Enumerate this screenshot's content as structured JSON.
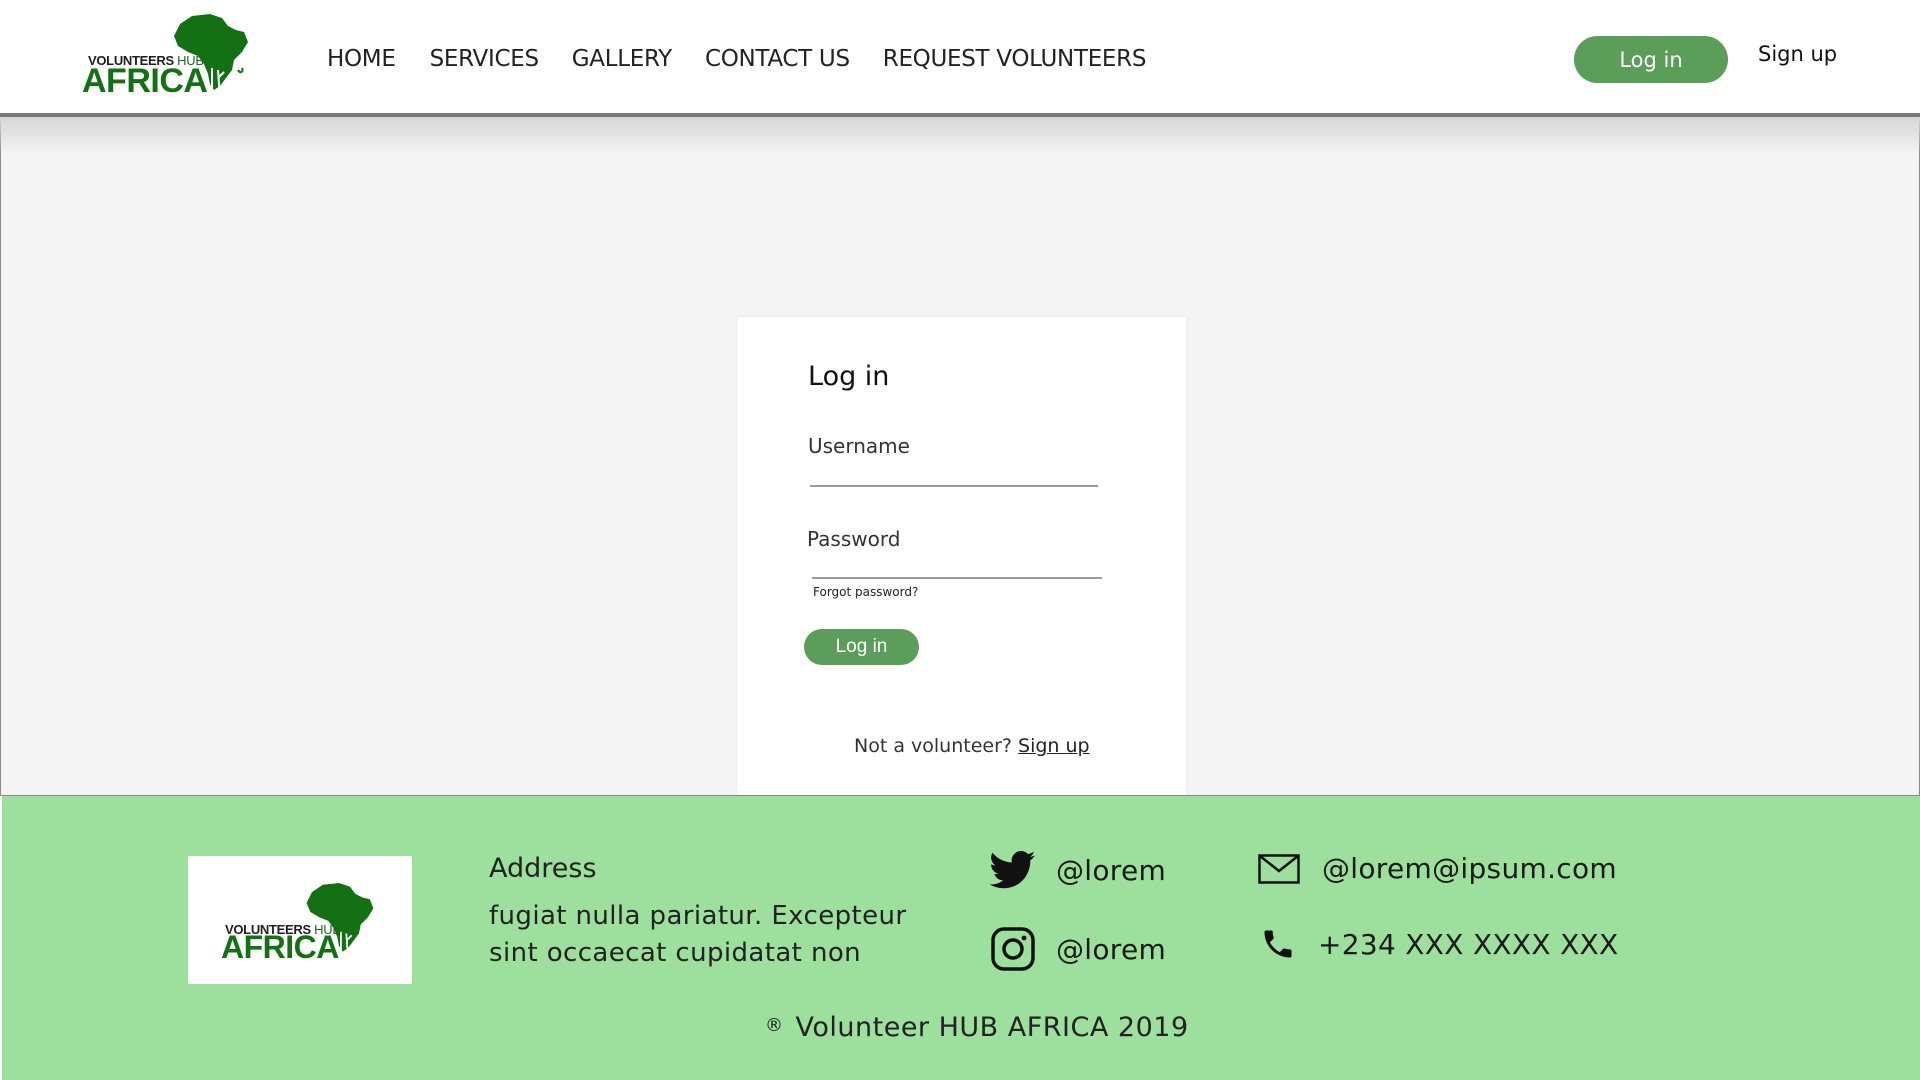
{
  "brand": {
    "logo_top_text": "VOLUNTEERS",
    "logo_hub_text": "HUB",
    "logo_main_text": "AFRICA",
    "logo_color": "#137013"
  },
  "nav": {
    "items": [
      "HOME",
      "SERVICES",
      "GALLERY",
      "CONTACT US",
      "REQUEST VOLUNTEERS"
    ]
  },
  "header": {
    "login_label": "Log in",
    "signup_label": "Sign up"
  },
  "login_card": {
    "title": "Log in",
    "username_label": "Username",
    "username_value": "",
    "password_label": "Password",
    "password_value": "",
    "forgot_label": "Forgot password?",
    "submit_label": "Log in",
    "not_volunteer_text": "Not a volunteer?",
    "signup_link": "Sign up"
  },
  "footer": {
    "address_title": "Address",
    "address_text": "fugiat nulla pariatur. Excepteur sint occaecat cupidatat non",
    "twitter": "@lorem",
    "instagram": "@lorem",
    "email": "@lorem@ipsum.com",
    "phone": "+234 XXX XXXX XXX",
    "copyright_symbol": "®",
    "copyright_text": "Volunteer HUB AFRICA 2019",
    "background_color": "#9ddf9d"
  },
  "colors": {
    "accent_green": "#5a9e5a",
    "main_background": "#f4f4f4"
  },
  "icons": {
    "twitter": "twitter-icon",
    "instagram": "instagram-icon",
    "email": "mail-icon",
    "phone": "phone-icon"
  }
}
